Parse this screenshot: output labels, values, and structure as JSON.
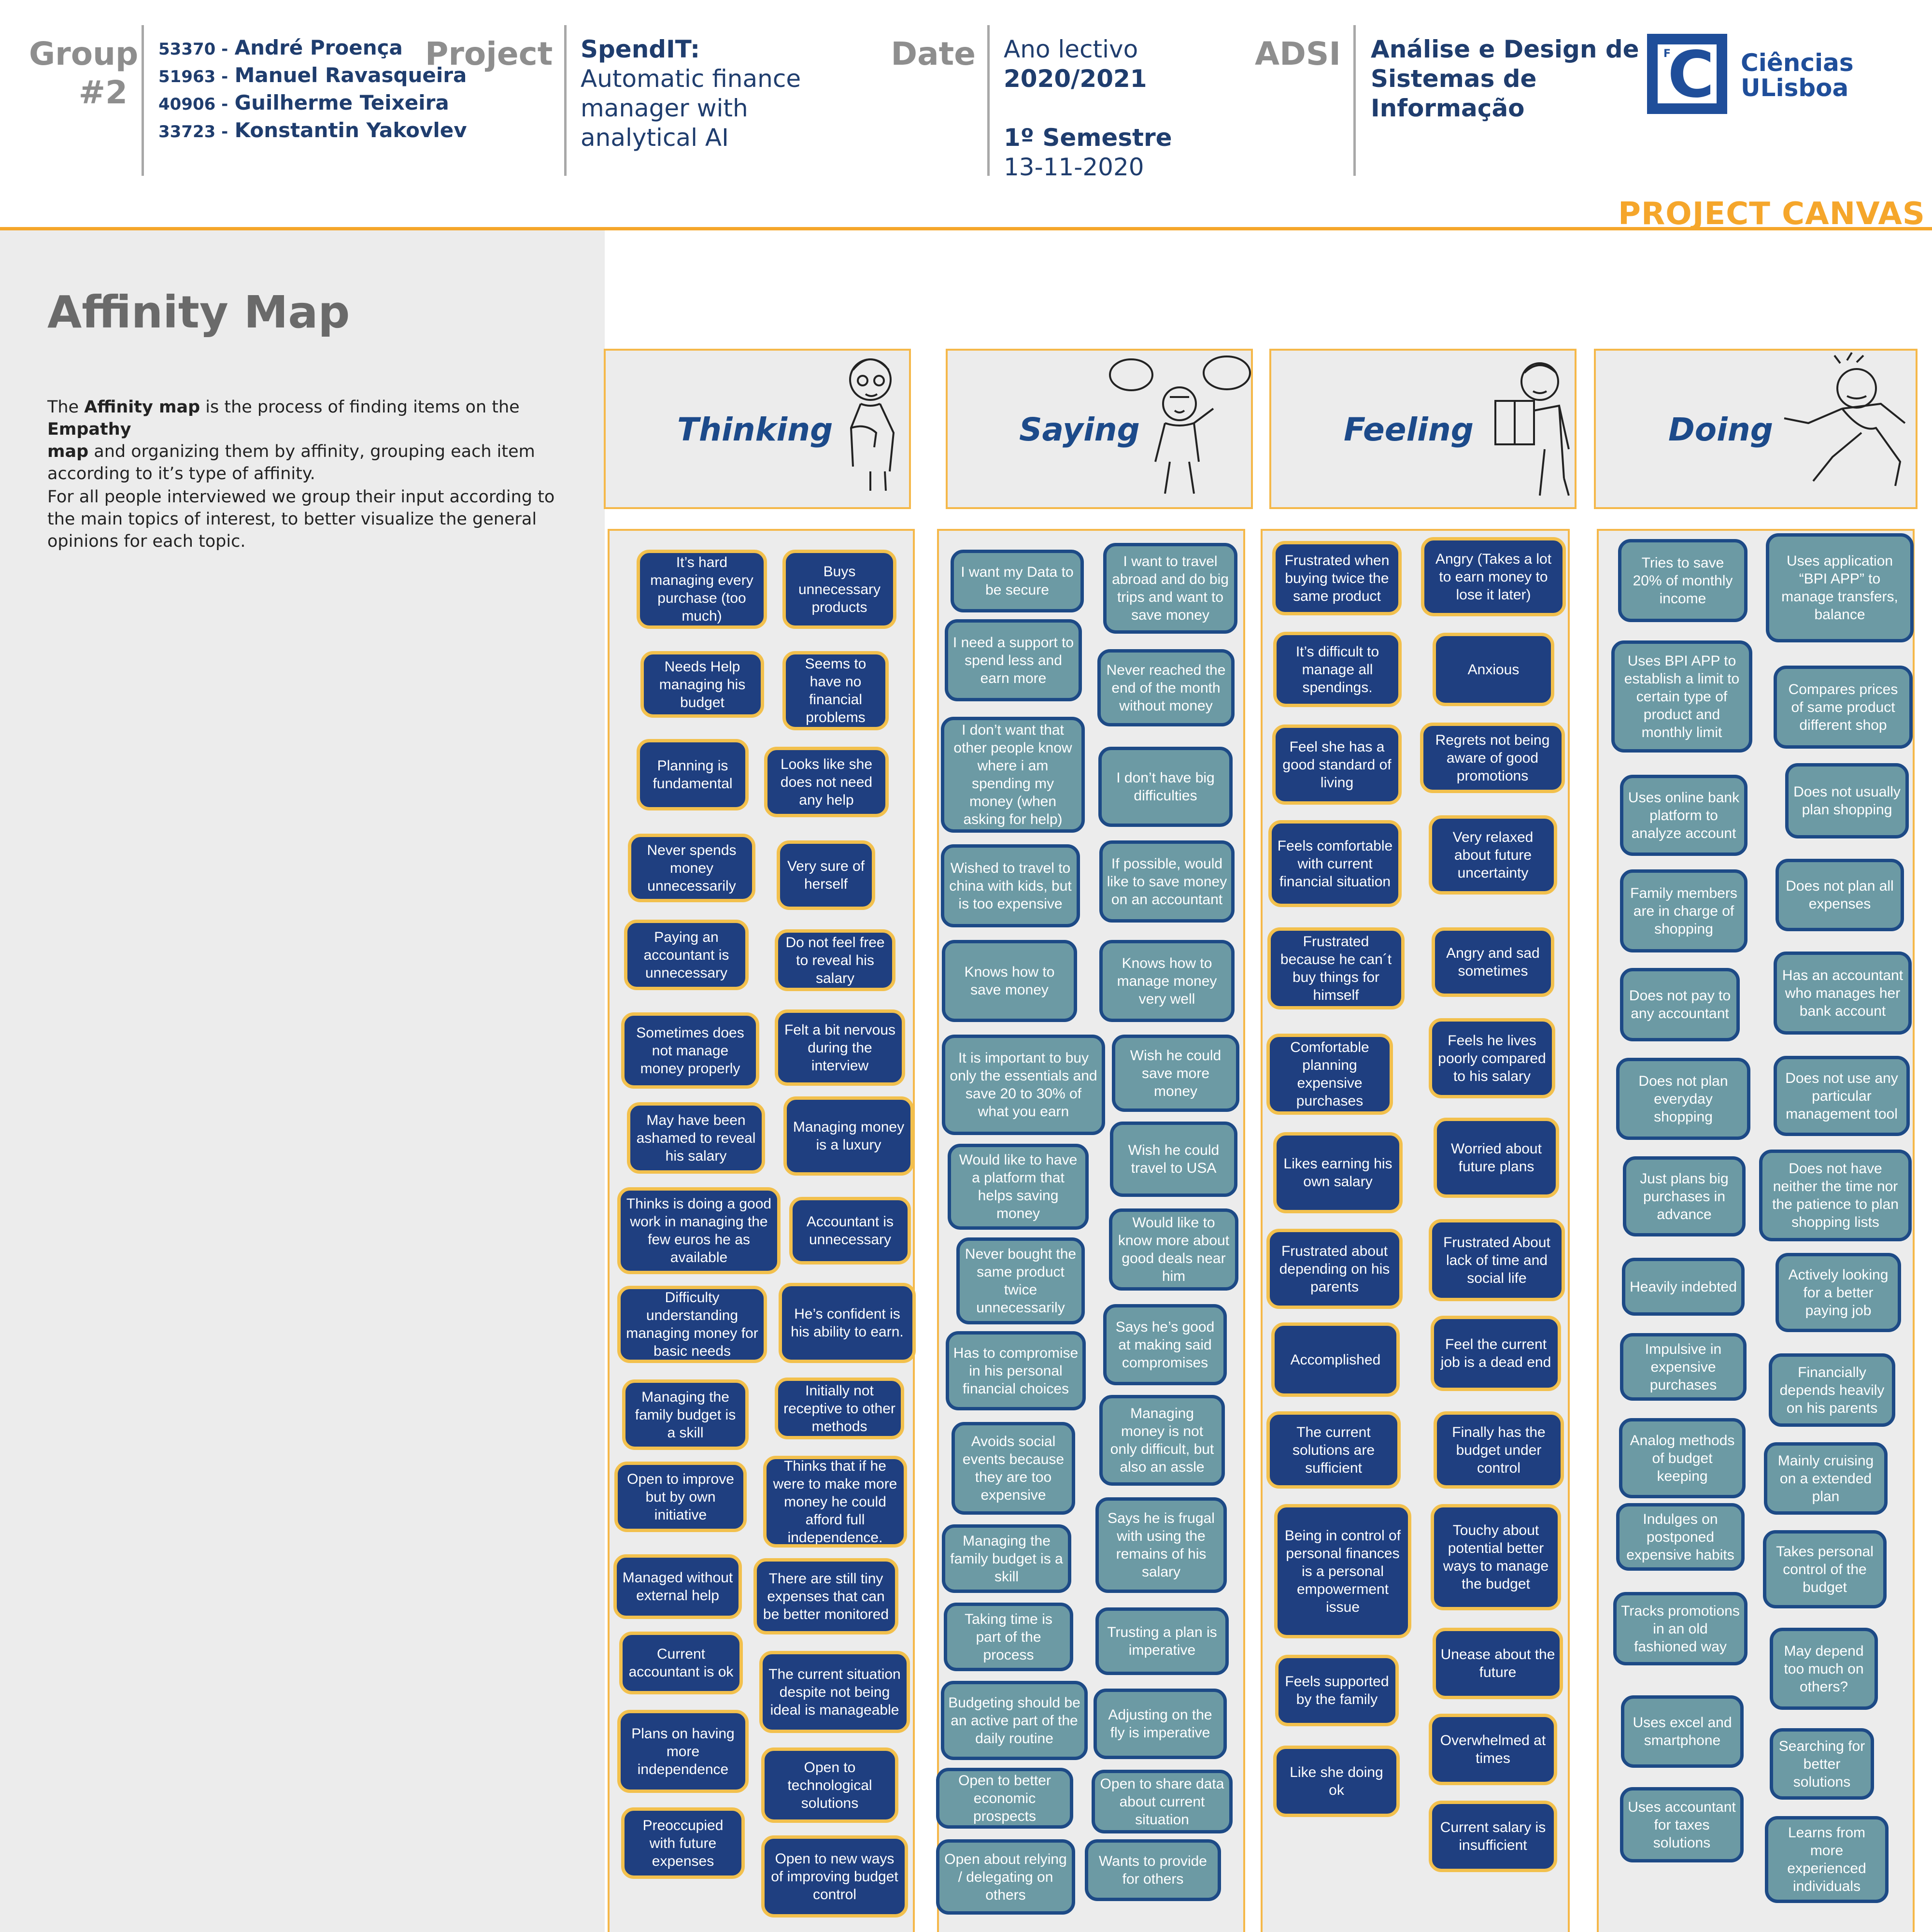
{
  "header": {
    "group_label": "Group",
    "group_number": "#2",
    "members": [
      {
        "id": "53370 -",
        "name": "André Proença"
      },
      {
        "id": "51963 -",
        "name": "Manuel Ravasqueira"
      },
      {
        "id": "40906 -",
        "name": "Guilherme Teixeira"
      },
      {
        "id": "33723 -",
        "name": "Konstantin Yakovlev"
      }
    ],
    "project_label": "Project",
    "project_name": "SpendIT:",
    "project_desc": [
      "Automatic finance",
      "manager with",
      "analytical AI"
    ],
    "date_label": "Date",
    "date_year_label": "Ano lectivo",
    "date_year": "2020/2021",
    "date_semester": "1º Semestre",
    "date_day": "13-11-2020",
    "course_label": "ADSI",
    "course_name": [
      "Análise e Design de",
      "Sistemas de",
      "Informação"
    ],
    "logo_letter": "C",
    "logo_small": "F",
    "logo_text": [
      "Ciências",
      "ULisboa"
    ],
    "canvas_title": "PROJECT CANVAS"
  },
  "intro": {
    "title": "Affinity Map",
    "p1_a": "The ",
    "p1_b": "Affinity map",
    "p1_c": " is the process of finding items on the ",
    "p1_d": "Empathy",
    "p1_e": "map",
    "p1_f": " and organizing them by affinity, grouping each item according to it’s type of affinity.",
    "p2": "For all people interviewed we group their input according to the main topics  of interest, to better visualize the general opinions for each topic."
  },
  "colors": {
    "orange": "#f5a62b",
    "navy": "#1f3f80",
    "teal": "#6c9aa4",
    "yellow_border": "#f2c04d",
    "blue_border": "#1d4a86"
  },
  "columns": [
    {
      "title": "Thinking",
      "icon": "thinking-figure-icon"
    },
    {
      "title": "Saying",
      "icon": "saying-figure-icon"
    },
    {
      "title": "Feeling",
      "icon": "feeling-figure-icon"
    },
    {
      "title": "Doing",
      "icon": "doing-figure-icon"
    }
  ],
  "notes": {
    "thinking": [
      "It’s hard managing every purchase (too much)",
      "Buys unnecessary products",
      "Needs Help managing his budget",
      "Seems to have no financial problems",
      "Planning is fundamental",
      "Looks like she does not need any help",
      "Never spends money unnecessarily",
      "Very sure of herself",
      "Paying an accountant is unnecessary",
      "Do not feel free to reveal his salary",
      "Sometimes does not manage money properly",
      "Felt a bit nervous during the interview",
      "May have been ashamed to reveal his salary",
      "Managing money is a luxury",
      "Thinks is doing a good work in managing the few euros he as available",
      "Accountant is unnecessary",
      "Difficulty understanding managing money for basic needs",
      "He’s confident is his ability to earn.",
      "Managing the family budget is a skill",
      "Initially not receptive to other methods",
      "Open to improve but by own initiative",
      "Thinks that if he were to make more money he could afford full independence.",
      "Managed without external help",
      "There are still tiny expenses that can be better monitored",
      "Current accountant is ok",
      "The current situation despite not being ideal is manageable",
      "Plans on having more independence",
      "Open to technological solutions",
      "Preoccupied with future expenses",
      "Open to new ways of improving budget control"
    ],
    "saying": [
      "I want my Data to be secure",
      "I want to travel abroad and do big trips and want to save money",
      "I need a support to spend less and earn more",
      "Never reached the end of the month without money",
      "I don’t want that other people know where i am spending my money (when asking for help)",
      "I don’t have big difficulties",
      "Wished to travel to china with kids, but is too expensive",
      "If possible, would like to save money on an accountant",
      "Knows how to save money",
      "Knows how to manage money very well",
      "It is important to buy only the essentials and save 20 to 30% of what you earn",
      "Wish he could save more money",
      "Would like to have a platform that helps saving money",
      "Wish he could travel to USA",
      "Never bought the same product twice unnecessarily",
      "Would like to know more about good deals near him",
      "Has to compromise in his personal financial choices",
      "Says he’s good at making said compromises",
      "Avoids social events because they are too expensive",
      "Managing money is not only difficult, but also an assle",
      "Managing the family budget is a skill",
      "Says he is frugal with using the remains of his salary",
      "Taking time is part of the process",
      "Trusting a plan is imperative",
      "Budgeting should be an active part of the daily routine",
      "Adjusting on the fly  is imperative",
      "Open to better economic prospects",
      "Open to share data about current situation",
      "Open about relying / delegating on others",
      "Wants to provide for others"
    ],
    "feeling": [
      "Frustrated when buying twice the same product",
      "Angry (Takes a lot to earn money to lose it later)",
      "It’s difficult to manage all spendings.",
      "Anxious",
      "Feel she has a good standard of living",
      "Regrets not being aware of good promotions",
      "Feels comfortable with current financial situation",
      "Very relaxed about future uncertainty",
      "Frustrated because he can´t buy things for himself",
      "Angry and sad sometimes",
      "Comfortable planning expensive purchases",
      "Feels he lives poorly compared to his salary",
      "Likes earning his own salary",
      "Worried about future plans",
      "Frustrated about depending on his parents",
      "Frustrated About lack of time and social life",
      "Accomplished",
      "Feel the current job is a dead end",
      "The current solutions are sufficient",
      "Finally has the budget under control",
      "Being in control of personal finances is a personal empowerment issue",
      "Touchy about potential better ways to manage the budget",
      "Feels supported by the family",
      "Unease about the future",
      "Overwhelmed at times",
      "Like she doing ok",
      "Current salary is insufficient"
    ],
    "doing": [
      "Tries to save 20% of monthly income",
      "Uses application “BPI APP” to manage transfers, balance",
      "Uses BPI APP to establish a limit to certain type of product and monthly limit",
      "Compares prices of same product different shop",
      "Uses online bank platform to analyze account",
      "Does not usually plan shopping",
      "Family members are in charge of shopping",
      "Does not plan all expenses",
      "Does not pay to any accountant",
      "Has an accountant who manages her bank account",
      "Does not plan everyday shopping",
      "Does not use any particular management tool",
      "Just plans big purchases in advance",
      "Does not have neither the time nor the patience to plan shopping lists",
      "Heavily indebted",
      "Actively looking for a better paying job",
      "Impulsive in expensive purchases",
      "Financially depends heavily on his parents",
      "Analog methods of budget keeping",
      "Mainly cruising on a extended plan",
      "Indulges on postponed expensive habits",
      "Takes personal control of the budget",
      "Tracks promotions in an old fashioned way",
      "May depend too much on others?",
      "Uses excel and smartphone",
      "Searching for better solutions",
      "Uses accountant for taxes solutions",
      "Learns from more experienced individuals"
    ]
  }
}
